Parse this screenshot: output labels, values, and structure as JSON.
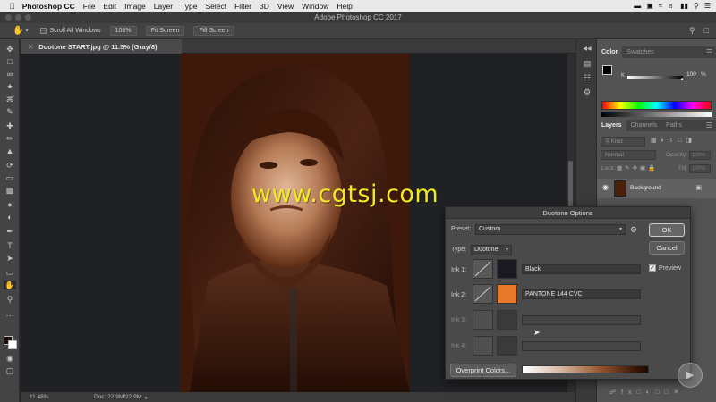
{
  "menubar": {
    "apple": "",
    "items": [
      "Photoshop CC",
      "File",
      "Edit",
      "Image",
      "Layer",
      "Type",
      "Select",
      "Filter",
      "3D",
      "View",
      "Window",
      "Help"
    ]
  },
  "window": {
    "title": "Adobe Photoshop CC 2017"
  },
  "options": {
    "scroll_all_label": "Scroll All Windows",
    "btn_100": "100%",
    "btn_fit": "Fit Screen",
    "btn_fill": "Fill Screen"
  },
  "document": {
    "tab_label": "Duotone START.jpg @ 11.5% (Gray/8)",
    "zoom": "11.48%",
    "doc_size": "Doc: 22.9M/22.9M"
  },
  "watermark": "www.cgtsj.com",
  "color_panel": {
    "tabs": [
      "Color",
      "Swatches"
    ],
    "k_label": "K",
    "k_value": "100",
    "k_percent": "%"
  },
  "layers_panel": {
    "tabs": [
      "Layers",
      "Channels",
      "Paths"
    ],
    "kind_label": "Kind",
    "blend_mode": "Normal",
    "opacity_label": "Opacity:",
    "opacity_value": "100%",
    "lock_label": "Lock:",
    "fill_label": "Fill:",
    "fill_value": "100%",
    "layer_name": "Background"
  },
  "dialog": {
    "title": "Duotone Options",
    "preset_label": "Preset:",
    "preset_value": "Custom",
    "type_label": "Type:",
    "type_value": "Duotone",
    "ok": "OK",
    "cancel": "Cancel",
    "preview_label": "Preview",
    "inks": [
      {
        "label": "Ink 1:",
        "name": "Black",
        "color": "#1a1820"
      },
      {
        "label": "Ink 2:",
        "name": "PANTONE 144 CVC",
        "color": "#e8782b"
      },
      {
        "label": "Ink 3:",
        "name": "",
        "color": "#3a3a3a"
      },
      {
        "label": "Ink 4:",
        "name": "",
        "color": "#3a3a3a"
      }
    ],
    "overprint_btn": "Overprint Colors..."
  },
  "colors": {
    "ink2": "#e8782b",
    "sepia_dark": "#3a170a"
  }
}
